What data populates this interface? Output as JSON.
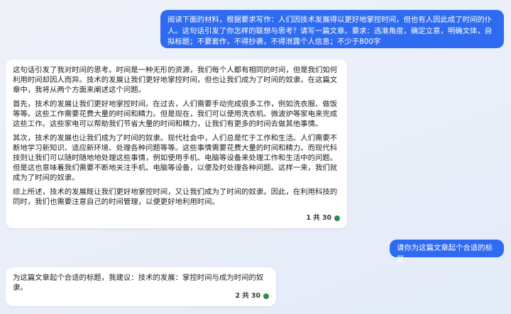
{
  "messages": {
    "user_1": "阅读下面的材料，根据要求写作：人们因技术发展得以更好地掌控时间，但也有人因此成了时间的仆人。这句话引发了你怎样的联想与思考？请写一篇文章。要求：选准角度，确定立意，明确文体，自拟标题；不要套作，不得抄袭，不得泄露个人信息；不少于800字",
    "bot_1": {
      "paragraphs": [
        "这句话引发了我对时间的思考。时间是一种无形的资源，我们每个人都有相同的时间，但是我们如何利用时间却因人而异。技术的发展让我们更好地掌控时间，但也让我们成为了时间的奴隶。在这篇文章中，我将从两个方面来阐述这个问题。",
        "首先，技术的发展让我们更好地掌控时间。在过去，人们需要手动完成很多工作，例如洗衣服、做饭等等。这些工作需要花费大量的时间和精力。但是现在，我们可以使用洗衣机、微波炉等家电来完成这些工作。这些家电可以帮助我们节省大量的时间和精力，让我们有更多的时间去做其他事情。",
        "其次，技术的发展也让我们成为了时间的奴隶。现代社会中，人们总是忙于工作和生活。人们需要不断地学习新知识、适应新环境、处理各种问题等等。这些事情需要花费大量的时间和精力。而现代科技则让我们可以随时随地地处理这些事情，例如使用手机、电脑等设备来处理工作和生活中的问题。但是这也意味着我们需要不断地关注手机、电脑等设备，以便及时处理各种问题。这样一来，我们就成为了时间的奴隶。",
        "综上所述，技术的发展既让我们更好地掌控时间，又让我们成为了时间的奴隶。因此，在利用科技的同时，我们也需要注意自己的时间管理，以便更好地利用时间。"
      ],
      "counter": "1 共 30"
    },
    "user_2": "请你为这篇文章起个合适的标题",
    "bot_2": {
      "text": "为这篇文章起个合适的标题，我建议：技术的发展：掌控时间与成为时间的奴隶。",
      "counter": "2 共 30"
    }
  },
  "colors": {
    "user_bubble": "#2f6bf0",
    "status_dot": "#2e8b4e"
  }
}
